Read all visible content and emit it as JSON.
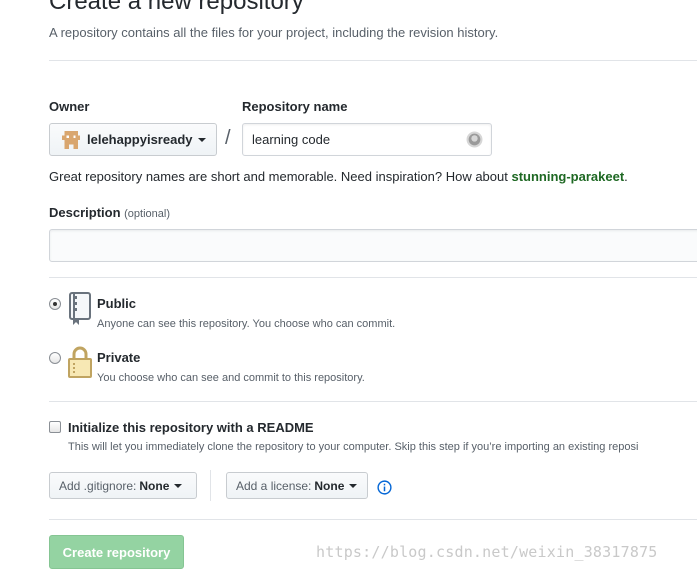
{
  "header": {
    "title": "Create a new repository",
    "subtitle": "A repository contains all the files for your project, including the revision history."
  },
  "owner": {
    "label": "Owner",
    "value": "lelehappyisready"
  },
  "repo_name": {
    "label": "Repository name",
    "value": "learning code"
  },
  "separator": "/",
  "name_hint": {
    "text": "Great repository names are short and memorable. Need inspiration? How about ",
    "suggestion": "stunning-parakeet",
    "end": "."
  },
  "description": {
    "label": "Description",
    "optional": "(optional)",
    "value": ""
  },
  "visibility": {
    "public": {
      "title": "Public",
      "note": "Anyone can see this repository. You choose who can commit.",
      "selected": true
    },
    "private": {
      "title": "Private",
      "note": "You choose who can see and commit to this repository.",
      "selected": false
    }
  },
  "readme": {
    "title": "Initialize this repository with a README",
    "note": "This will let you immediately clone the repository to your computer. Skip this step if you’re importing an existing reposi",
    "checked": false
  },
  "gitignore": {
    "label": "Add .gitignore:",
    "value": "None"
  },
  "license": {
    "label": "Add a license:",
    "value": "None"
  },
  "create_button": "Create repository",
  "watermark": "https://blog.csdn.net/weixin_38317875",
  "colors": {
    "accent_green": "#28a745",
    "disabled_green": "#94d3a2",
    "link_blue": "#0366d6"
  }
}
